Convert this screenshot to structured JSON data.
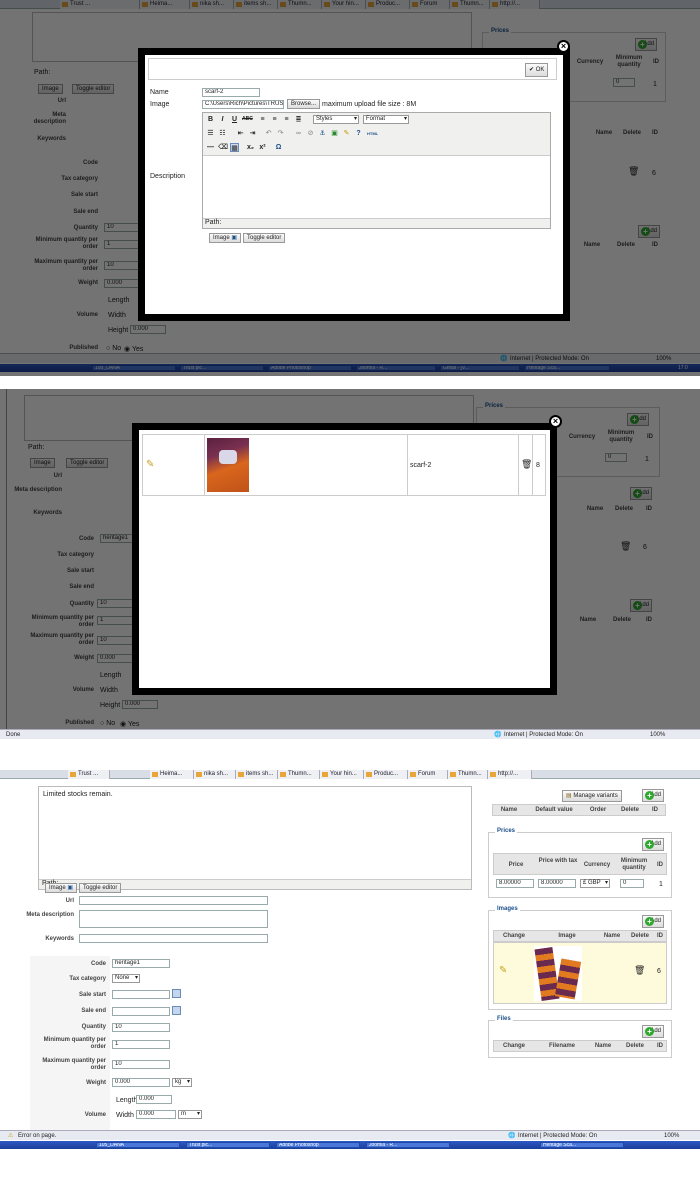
{
  "colors": {
    "legend": "#1a4f8a",
    "add_green": "#2fa82f",
    "taskbar": "#2c59c6",
    "overlay": "#000000"
  },
  "browser": {
    "tabs": [
      "Trust ...",
      "Heima...",
      "nika sh...",
      "items sh...",
      "Thumn...",
      "Your hin...",
      "Produc...",
      "Forum",
      "Thumn...",
      "http://..."
    ],
    "status_panel1": "",
    "status_panel2": "Done",
    "status_panel3": "Error on page.",
    "protected_mode": "Internet | Protected Mode: On",
    "zoom": "100%"
  },
  "taskbar1": [
    "105_DANA",
    "Trust pic...",
    "Adobe Photoshop",
    "Joomla - R...",
    "Gmail - [V...",
    "Heritage Sca..."
  ],
  "taskbar1_clock": "17:0",
  "taskbar3": [
    "105_DANA",
    "Trust pic...",
    "Adobe Photoshop",
    "Joomla - R...",
    "Heritage Sca..."
  ],
  "editor": {
    "path_label": "Path:",
    "image_btn": "Image",
    "toggle_btn": "Toggle editor",
    "text": "Limited stocks remain.",
    "styles": "Styles",
    "format": "Format"
  },
  "form": {
    "url_label": "Url",
    "meta_label": "Meta description",
    "keywords_label": "Keywords",
    "code_label": "Code",
    "code_value": "heritage1",
    "tax_label": "Tax category",
    "tax_value": "None",
    "sale_start_label": "Sale start",
    "sale_end_label": "Sale end",
    "quantity_label": "Quantity",
    "quantity_value": "10",
    "min_qty_label": "Minimum quantity per order",
    "min_qty_value": "1",
    "max_qty_label": "Maximum quantity per order",
    "max_qty_value": "10",
    "weight_label": "Weight",
    "weight_value": "0.000",
    "weight_unit": "kg",
    "volume_label": "Volume",
    "length_label": "Length",
    "length_value": "0.000",
    "width_label": "Width",
    "width_value": "0.000",
    "width_unit": "m",
    "height_label": "Height",
    "height_value": "0.000",
    "published_label": "Published",
    "no_label": "No",
    "yes_label": "Yes"
  },
  "variants": {
    "manage_btn": "Manage variants",
    "add_label": "Add",
    "headers": [
      "Name",
      "Default value",
      "Order",
      "Delete",
      "ID"
    ]
  },
  "prices": {
    "legend": "Prices",
    "add_label": "Add",
    "headers": [
      "Price",
      "Price with tax",
      "Currency",
      "Minimum quantity",
      "ID"
    ],
    "row": {
      "price": "8.00000",
      "price_tax": "8.00000",
      "currency": "£ GBP",
      "min_qty": "0",
      "id": "1"
    }
  },
  "images": {
    "legend": "Images",
    "add_label": "Add",
    "headers": [
      "Change",
      "Image",
      "Name",
      "Delete",
      "ID"
    ],
    "row_id": "6"
  },
  "files": {
    "legend": "Files",
    "add_label": "Add",
    "headers": [
      "Change",
      "Filename",
      "Name",
      "Delete",
      "ID"
    ]
  },
  "upload_dialog": {
    "ok_label": "OK",
    "name_label": "Name",
    "name_value": "scarf-2",
    "image_label": "Image",
    "file_path": "C:\\Users\\Rich\\Pictures\\TRUST !",
    "browse_btn": "Browse...",
    "max_size": "maximum upload file size : 8M",
    "description_label": "Description",
    "path_label": "Path:",
    "image_btn": "Image",
    "toggle_btn": "Toggle editor"
  },
  "result_dialog": {
    "name": "scarf-2",
    "id": "8"
  }
}
